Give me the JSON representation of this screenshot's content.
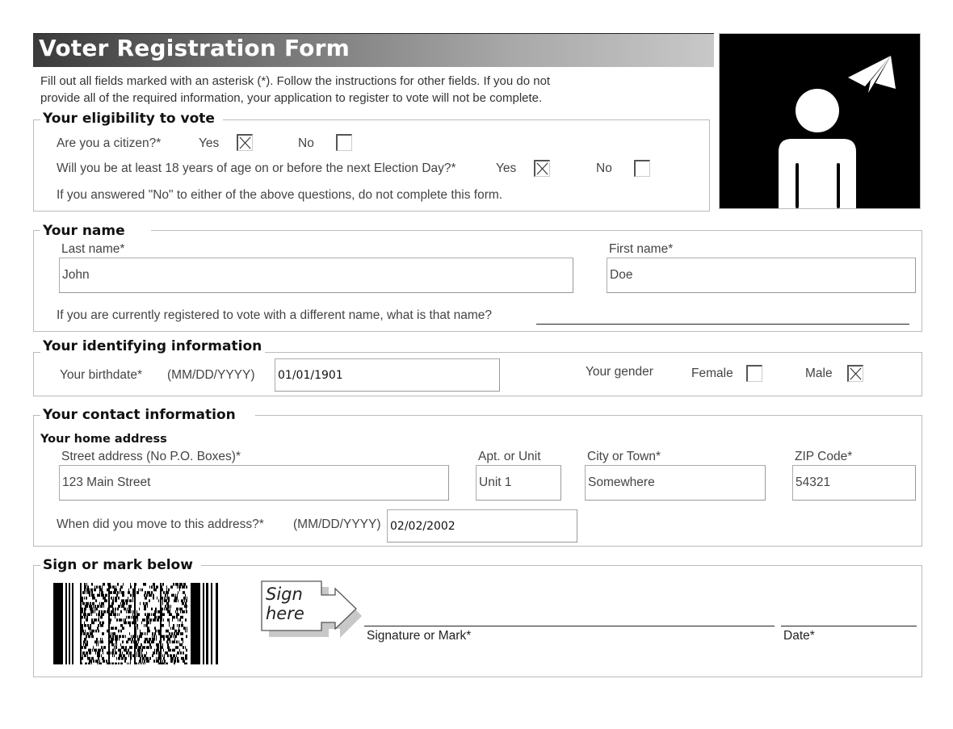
{
  "header": {
    "title": "Voter  Registration Form",
    "intro_line1": "Fill out all fields marked with an asterisk (*). Follow the instructions for other fields. If you do not",
    "intro_line2": "provide all of the required information, your application to register to vote will not be complete."
  },
  "illustration": {
    "icon": "person-with-paper-plane-icon"
  },
  "eligibility": {
    "legend": "Your eligibility to vote",
    "citizen_question": "Are you a citizen?*",
    "age_question": "Will you be at least 18 years of age on or before the next Election Day?*",
    "yes_label": "Yes",
    "no_label": "No",
    "citizen_yes_checked": true,
    "citizen_no_checked": false,
    "age_yes_checked": true,
    "age_no_checked": false,
    "note": "If you answered \"No\" to either of the above questions, do not complete this form."
  },
  "name": {
    "legend": "Your name",
    "last_name_label": "Last name*",
    "last_name_value": "John",
    "first_name_label": "First name*",
    "first_name_value": "Doe",
    "previous_name_question": "If you are currently registered to vote with a different name, what is that name?",
    "previous_name_value": ""
  },
  "identifying": {
    "legend": "Your identifying information",
    "birthdate_label": "Your birthdate*",
    "birthdate_format": "(MM/DD/YYYY)",
    "birthdate_value": "01/01/1901",
    "gender_label": "Your gender",
    "female_label": "Female",
    "male_label": "Male",
    "female_checked": false,
    "male_checked": true
  },
  "contact": {
    "legend": "Your contact information",
    "home_address_heading": "Your home address",
    "street_label": "Street address (No P.O. Boxes)*",
    "street_value": "123 Main Street",
    "apt_label": "Apt. or Unit",
    "apt_value": "Unit 1",
    "city_label": "City or Town*",
    "city_value": "Somewhere",
    "zip_label": "ZIP Code*",
    "zip_value": "54321",
    "move_date_label": "When did you move to this address?*",
    "move_date_format": "(MM/DD/YYYY)",
    "move_date_value": "02/02/2002"
  },
  "signature": {
    "legend": "Sign or mark below",
    "sign_here_line1": "Sign",
    "sign_here_line2": "here",
    "signature_label": "Signature or Mark*",
    "date_label": "Date*",
    "barcode": "pdf417-barcode"
  }
}
